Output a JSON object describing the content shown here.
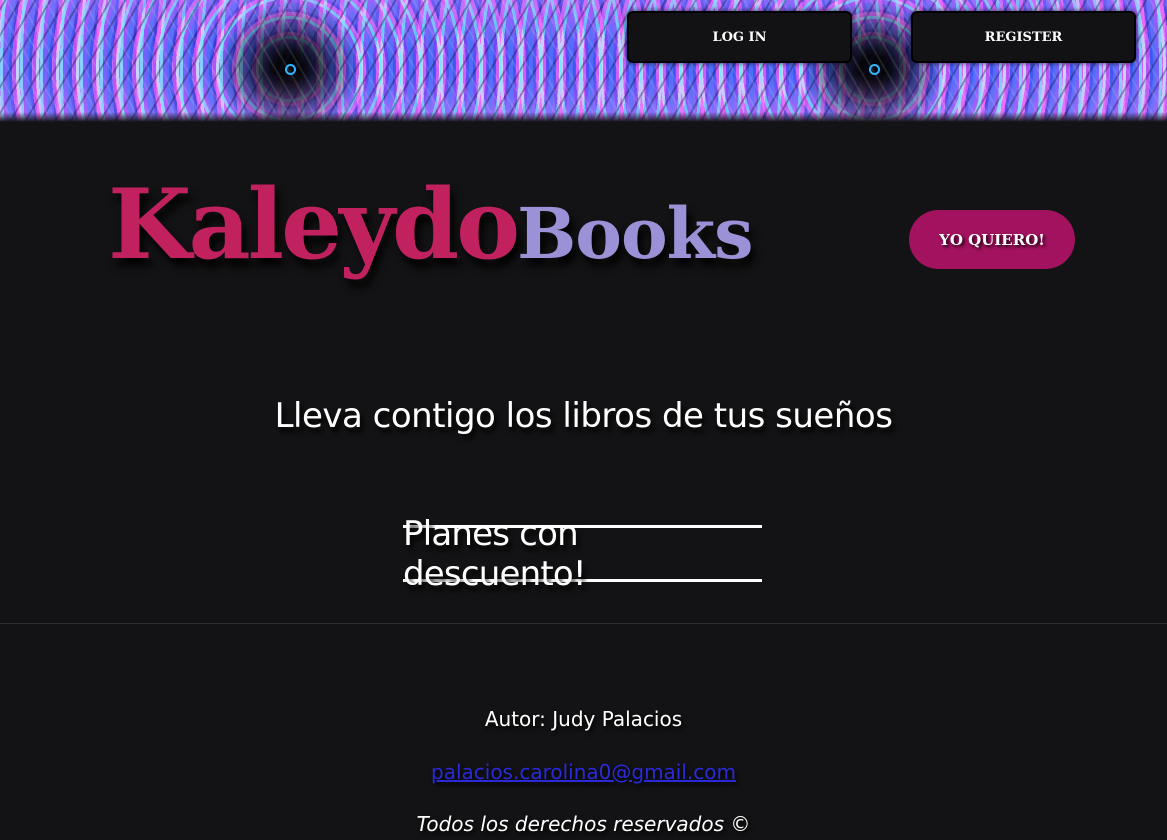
{
  "nav": {
    "login_label": "LOG IN",
    "register_label": "REGISTER"
  },
  "hero": {
    "logo_part1": "Kaleydo",
    "logo_part2": "Books",
    "cta_label": "YO QUIERO!",
    "tagline": "Lleva contigo los libros de tus sueños",
    "plans_label": "Planes con descuento!"
  },
  "footer": {
    "author": "Autor: Judy Palacios",
    "email": "palacios.carolina0@gmail.com",
    "rights": "Todos los derechos reservados ©"
  },
  "colors": {
    "background": "#131214",
    "logo_primary": "#c2215f",
    "logo_secondary": "#9a91d6",
    "cta_background": "#a3125f",
    "link": "#2a2ad8"
  }
}
